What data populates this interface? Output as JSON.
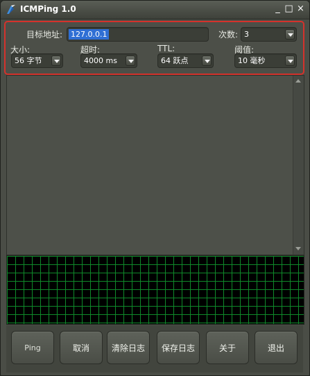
{
  "window": {
    "title": "ICMPing 1.0",
    "min_glyph": "_",
    "max_glyph": "□",
    "close_glyph": "×"
  },
  "settings": {
    "target_label": "目标地址:",
    "target_value": "127.0.0.1",
    "count_label": "次数:",
    "count_value": "3",
    "size_label": "大小:",
    "size_value": "56 字节",
    "timeout_label": "超时:",
    "timeout_value": "4000 ms",
    "ttl_label": "TTL:",
    "ttl_value": "64 跃点",
    "threshold_label": "阈值:",
    "threshold_value": "10 毫秒"
  },
  "graph": {
    "grid_color": "#0f8a2a",
    "background": "#000000"
  },
  "buttons": {
    "ping": "Ping",
    "cancel": "取消",
    "clear_log": "清除日志",
    "save_log": "保存日志",
    "about": "关于",
    "exit": "退出"
  },
  "colors": {
    "highlight_border": "#d5322c",
    "selection": "#2f6fd4"
  }
}
